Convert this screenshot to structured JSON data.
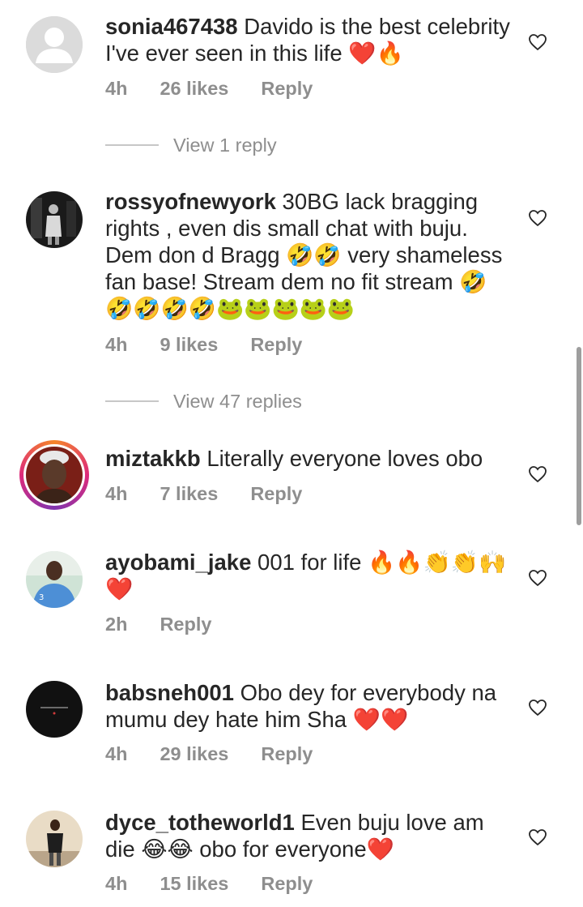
{
  "comments": [
    {
      "username": "sonia467438",
      "text": " Davido is the best celebrity I've ever seen in this life ❤️🔥",
      "time": "4h",
      "likes": "26 likes",
      "reply": "Reply",
      "view_replies": "View 1 reply"
    },
    {
      "username": "rossyofnewyork",
      "text": " 30BG lack bragging rights , even dis small  chat with buju. Dem don d Bragg 🤣🤣 very shameless fan base! Stream dem no fit stream 🤣🤣🤣🤣🤣🐸🐸🐸🐸🐸",
      "time": "4h",
      "likes": "9 likes",
      "reply": "Reply",
      "view_replies": "View 47 replies"
    },
    {
      "username": "miztakkb",
      "text": " Literally everyone loves obo",
      "time": "4h",
      "likes": "7 likes",
      "reply": "Reply"
    },
    {
      "username": "ayobami_jake",
      "text": " 001 for life 🔥🔥👏👏🙌❤️",
      "time": "2h",
      "reply": "Reply"
    },
    {
      "username": "babsneh001",
      "text": " Obo dey for everybody na mumu dey hate him Sha ❤️❤️",
      "time": "4h",
      "likes": "29 likes",
      "reply": "Reply"
    },
    {
      "username": "dyce_totheworld1",
      "text": " Even buju love am die 😂😂 obo for everyone❤️",
      "time": "4h",
      "likes": "15 likes",
      "reply": "Reply"
    }
  ],
  "icons": {
    "like": "heart-outline-icon",
    "default_avatar": "person-silhouette-icon"
  },
  "colors": {
    "text": "#262626",
    "muted": "#8e8e8e",
    "divider": "#c7c7c7"
  }
}
